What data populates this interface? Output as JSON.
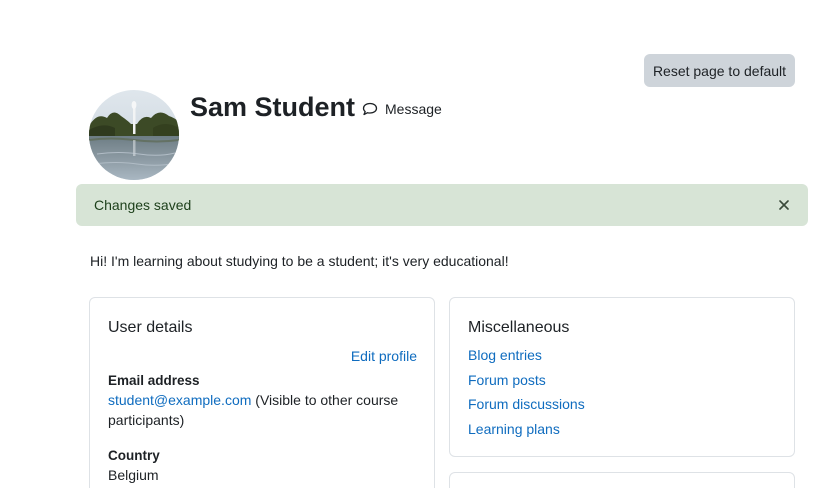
{
  "header": {
    "reset_label": "Reset page to default",
    "user_name": "Sam Student",
    "message_label": "Message"
  },
  "alert": {
    "text": "Changes saved",
    "close_symbol": "×"
  },
  "profile": {
    "description": "Hi! I'm learning about studying to be a student; it's very educational!"
  },
  "user_details": {
    "title": "User details",
    "edit_label": "Edit profile",
    "email_label": "Email address",
    "email_value": "student@example.com",
    "email_note": " (Visible to other course participants)",
    "country_label": "Country",
    "country_value": "Belgium"
  },
  "miscellaneous": {
    "title": "Miscellaneous",
    "links": [
      "Blog entries",
      "Forum posts",
      "Forum discussions",
      "Learning plans"
    ]
  },
  "colors": {
    "link": "#0f6cbf",
    "alert_bg": "#d7e4d6",
    "button_bg": "#ced4da"
  },
  "icons": {
    "message": "speech-bubble-icon",
    "close": "close-icon"
  }
}
